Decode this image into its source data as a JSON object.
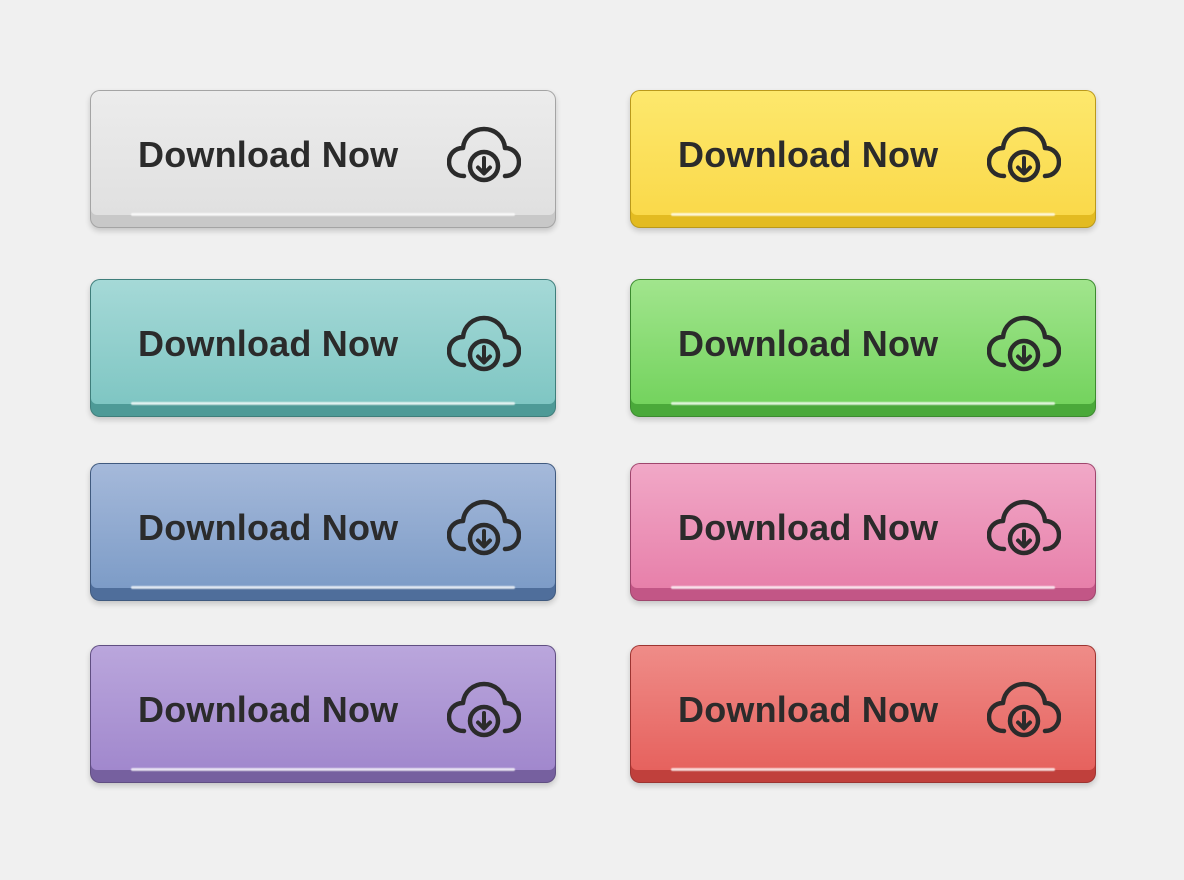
{
  "buttons": [
    {
      "label": "Download Now",
      "icon": "cloud-download-icon",
      "top": "#ececec",
      "bottom": "#e0e0e0",
      "base": "#c8c8c8"
    },
    {
      "label": "Download Now",
      "icon": "cloud-download-icon",
      "top": "#fde86d",
      "bottom": "#fad94a",
      "base": "#e3bb21"
    },
    {
      "label": "Download Now",
      "icon": "cloud-download-icon",
      "top": "#a5d9d7",
      "bottom": "#7fc6c3",
      "base": "#4e9a97"
    },
    {
      "label": "Download Now",
      "icon": "cloud-download-icon",
      "top": "#a1e58d",
      "bottom": "#74d35e",
      "base": "#4aa93a"
    },
    {
      "label": "Download Now",
      "icon": "cloud-download-icon",
      "top": "#a5b9da",
      "bottom": "#7d9cc7",
      "base": "#4f6e9b"
    },
    {
      "label": "Download Now",
      "icon": "cloud-download-icon",
      "top": "#f1a8c7",
      "bottom": "#e780aa",
      "base": "#c25686"
    },
    {
      "label": "Download Now",
      "icon": "cloud-download-icon",
      "top": "#baa6dc",
      "bottom": "#a188cd",
      "base": "#76609f"
    },
    {
      "label": "Download Now",
      "icon": "cloud-download-icon",
      "top": "#ef8c88",
      "bottom": "#e6625e",
      "base": "#c0403c"
    }
  ]
}
